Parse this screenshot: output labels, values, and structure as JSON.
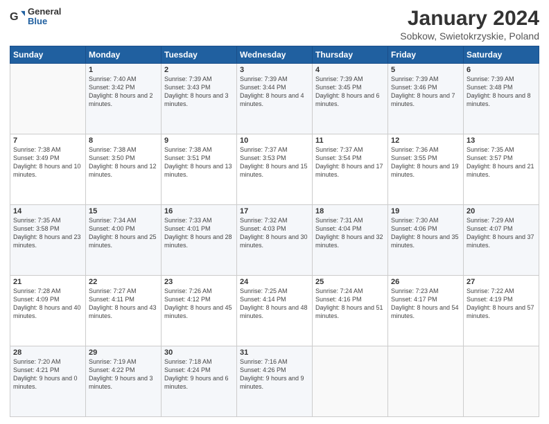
{
  "header": {
    "logo_general": "General",
    "logo_blue": "Blue",
    "month": "January 2024",
    "location": "Sobkow, Swietokrzyskie, Poland"
  },
  "weekdays": [
    "Sunday",
    "Monday",
    "Tuesday",
    "Wednesday",
    "Thursday",
    "Friday",
    "Saturday"
  ],
  "weeks": [
    [
      {
        "day": "",
        "sunrise": "",
        "sunset": "",
        "daylight": ""
      },
      {
        "day": "1",
        "sunrise": "Sunrise: 7:40 AM",
        "sunset": "Sunset: 3:42 PM",
        "daylight": "Daylight: 8 hours and 2 minutes."
      },
      {
        "day": "2",
        "sunrise": "Sunrise: 7:39 AM",
        "sunset": "Sunset: 3:43 PM",
        "daylight": "Daylight: 8 hours and 3 minutes."
      },
      {
        "day": "3",
        "sunrise": "Sunrise: 7:39 AM",
        "sunset": "Sunset: 3:44 PM",
        "daylight": "Daylight: 8 hours and 4 minutes."
      },
      {
        "day": "4",
        "sunrise": "Sunrise: 7:39 AM",
        "sunset": "Sunset: 3:45 PM",
        "daylight": "Daylight: 8 hours and 6 minutes."
      },
      {
        "day": "5",
        "sunrise": "Sunrise: 7:39 AM",
        "sunset": "Sunset: 3:46 PM",
        "daylight": "Daylight: 8 hours and 7 minutes."
      },
      {
        "day": "6",
        "sunrise": "Sunrise: 7:39 AM",
        "sunset": "Sunset: 3:48 PM",
        "daylight": "Daylight: 8 hours and 8 minutes."
      }
    ],
    [
      {
        "day": "7",
        "sunrise": "Sunrise: 7:38 AM",
        "sunset": "Sunset: 3:49 PM",
        "daylight": "Daylight: 8 hours and 10 minutes."
      },
      {
        "day": "8",
        "sunrise": "Sunrise: 7:38 AM",
        "sunset": "Sunset: 3:50 PM",
        "daylight": "Daylight: 8 hours and 12 minutes."
      },
      {
        "day": "9",
        "sunrise": "Sunrise: 7:38 AM",
        "sunset": "Sunset: 3:51 PM",
        "daylight": "Daylight: 8 hours and 13 minutes."
      },
      {
        "day": "10",
        "sunrise": "Sunrise: 7:37 AM",
        "sunset": "Sunset: 3:53 PM",
        "daylight": "Daylight: 8 hours and 15 minutes."
      },
      {
        "day": "11",
        "sunrise": "Sunrise: 7:37 AM",
        "sunset": "Sunset: 3:54 PM",
        "daylight": "Daylight: 8 hours and 17 minutes."
      },
      {
        "day": "12",
        "sunrise": "Sunrise: 7:36 AM",
        "sunset": "Sunset: 3:55 PM",
        "daylight": "Daylight: 8 hours and 19 minutes."
      },
      {
        "day": "13",
        "sunrise": "Sunrise: 7:35 AM",
        "sunset": "Sunset: 3:57 PM",
        "daylight": "Daylight: 8 hours and 21 minutes."
      }
    ],
    [
      {
        "day": "14",
        "sunrise": "Sunrise: 7:35 AM",
        "sunset": "Sunset: 3:58 PM",
        "daylight": "Daylight: 8 hours and 23 minutes."
      },
      {
        "day": "15",
        "sunrise": "Sunrise: 7:34 AM",
        "sunset": "Sunset: 4:00 PM",
        "daylight": "Daylight: 8 hours and 25 minutes."
      },
      {
        "day": "16",
        "sunrise": "Sunrise: 7:33 AM",
        "sunset": "Sunset: 4:01 PM",
        "daylight": "Daylight: 8 hours and 28 minutes."
      },
      {
        "day": "17",
        "sunrise": "Sunrise: 7:32 AM",
        "sunset": "Sunset: 4:03 PM",
        "daylight": "Daylight: 8 hours and 30 minutes."
      },
      {
        "day": "18",
        "sunrise": "Sunrise: 7:31 AM",
        "sunset": "Sunset: 4:04 PM",
        "daylight": "Daylight: 8 hours and 32 minutes."
      },
      {
        "day": "19",
        "sunrise": "Sunrise: 7:30 AM",
        "sunset": "Sunset: 4:06 PM",
        "daylight": "Daylight: 8 hours and 35 minutes."
      },
      {
        "day": "20",
        "sunrise": "Sunrise: 7:29 AM",
        "sunset": "Sunset: 4:07 PM",
        "daylight": "Daylight: 8 hours and 37 minutes."
      }
    ],
    [
      {
        "day": "21",
        "sunrise": "Sunrise: 7:28 AM",
        "sunset": "Sunset: 4:09 PM",
        "daylight": "Daylight: 8 hours and 40 minutes."
      },
      {
        "day": "22",
        "sunrise": "Sunrise: 7:27 AM",
        "sunset": "Sunset: 4:11 PM",
        "daylight": "Daylight: 8 hours and 43 minutes."
      },
      {
        "day": "23",
        "sunrise": "Sunrise: 7:26 AM",
        "sunset": "Sunset: 4:12 PM",
        "daylight": "Daylight: 8 hours and 45 minutes."
      },
      {
        "day": "24",
        "sunrise": "Sunrise: 7:25 AM",
        "sunset": "Sunset: 4:14 PM",
        "daylight": "Daylight: 8 hours and 48 minutes."
      },
      {
        "day": "25",
        "sunrise": "Sunrise: 7:24 AM",
        "sunset": "Sunset: 4:16 PM",
        "daylight": "Daylight: 8 hours and 51 minutes."
      },
      {
        "day": "26",
        "sunrise": "Sunrise: 7:23 AM",
        "sunset": "Sunset: 4:17 PM",
        "daylight": "Daylight: 8 hours and 54 minutes."
      },
      {
        "day": "27",
        "sunrise": "Sunrise: 7:22 AM",
        "sunset": "Sunset: 4:19 PM",
        "daylight": "Daylight: 8 hours and 57 minutes."
      }
    ],
    [
      {
        "day": "28",
        "sunrise": "Sunrise: 7:20 AM",
        "sunset": "Sunset: 4:21 PM",
        "daylight": "Daylight: 9 hours and 0 minutes."
      },
      {
        "day": "29",
        "sunrise": "Sunrise: 7:19 AM",
        "sunset": "Sunset: 4:22 PM",
        "daylight": "Daylight: 9 hours and 3 minutes."
      },
      {
        "day": "30",
        "sunrise": "Sunrise: 7:18 AM",
        "sunset": "Sunset: 4:24 PM",
        "daylight": "Daylight: 9 hours and 6 minutes."
      },
      {
        "day": "31",
        "sunrise": "Sunrise: 7:16 AM",
        "sunset": "Sunset: 4:26 PM",
        "daylight": "Daylight: 9 hours and 9 minutes."
      },
      {
        "day": "",
        "sunrise": "",
        "sunset": "",
        "daylight": ""
      },
      {
        "day": "",
        "sunrise": "",
        "sunset": "",
        "daylight": ""
      },
      {
        "day": "",
        "sunrise": "",
        "sunset": "",
        "daylight": ""
      }
    ]
  ]
}
